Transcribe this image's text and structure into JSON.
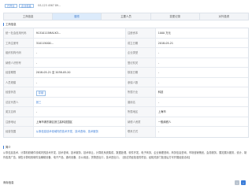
{
  "header": {
    "tag_a": "已开业",
    "tag_b": "企业信息",
    "crumb": "GS-123 4567 89..."
  },
  "tabs": [
    {
      "label": "工商信息"
    },
    {
      "label": "股东",
      "active": true
    },
    {
      "label": "主要人员"
    },
    {
      "label": "变更记录"
    },
    {
      "label": "对外投资"
    }
  ],
  "info": {
    "title": "工商信息",
    "rows": [
      {
        "l1": "统一社会信用代码",
        "v1": "91310115MA1K3...",
        "l2": "注册资本",
        "v2": "1000 万元"
      },
      {
        "l1": "工商注册号",
        "v1": "310115000...",
        "l2": "成立日期",
        "v2": "2018-05-21"
      },
      {
        "l1": "组织机构代码",
        "v1": "-",
        "l2": "企业类型",
        "v2": "-"
      },
      {
        "l1": "纳税人识别号",
        "v1": "-",
        "l2": "登记机关",
        "v2": "-"
      },
      {
        "l1": "经营期限",
        "v1": "2018-05-21 至 2038-05-20",
        "l2": "核准日期",
        "v2": "-"
      },
      {
        "l1": "人员规模",
        "v1": "-",
        "l2": "参保人数",
        "v2": "-"
      },
      {
        "l1": "经营状态",
        "v1": "存续",
        "l2": "所属行业",
        "v2": "科技"
      },
      {
        "l1": "法定代表人",
        "v1": "张三",
        "l2": "曾用名",
        "v2": "-"
      },
      {
        "l1": "英文名称",
        "v1": "-",
        "l2": "所属地区",
        "v2": "上海市"
      },
      {
        "l1": "注册地址",
        "v1": "上海市浦东新区张江高科技园区",
        "l2": "纳税人资质",
        "v2": "一般纳税人"
      },
      {
        "l1": "经营范围",
        "v1": "从事信息技术领域内的技术开发、技术咨询、技术服务",
        "l2": "联系方式",
        "v2": "-"
      }
    ]
  },
  "description": {
    "title": "简介",
    "text": "从事信息技术、计算机软硬件领域内的技术开发、技术咨询、技术服务、技术转让，计算机系统集成，数据处理，软件开发，电子商务，企业管理咨询，商务信息咨询，市场营销策划，会务服务，展览展示服务，设计、制作各类广告，销售计算机软硬件及辅助设备、电子产品、通讯设备、办公用品，货物进出口，技术进出口。【依法须经批准的项目，经相关部门批准后方可开展经营活动】"
  },
  "footer": {
    "label": "商标信息",
    "btn1": "‹",
    "btn2": "›"
  },
  "colors": {
    "accent": "#3b7dd8",
    "tab_active_bg": "#dcebfb"
  }
}
